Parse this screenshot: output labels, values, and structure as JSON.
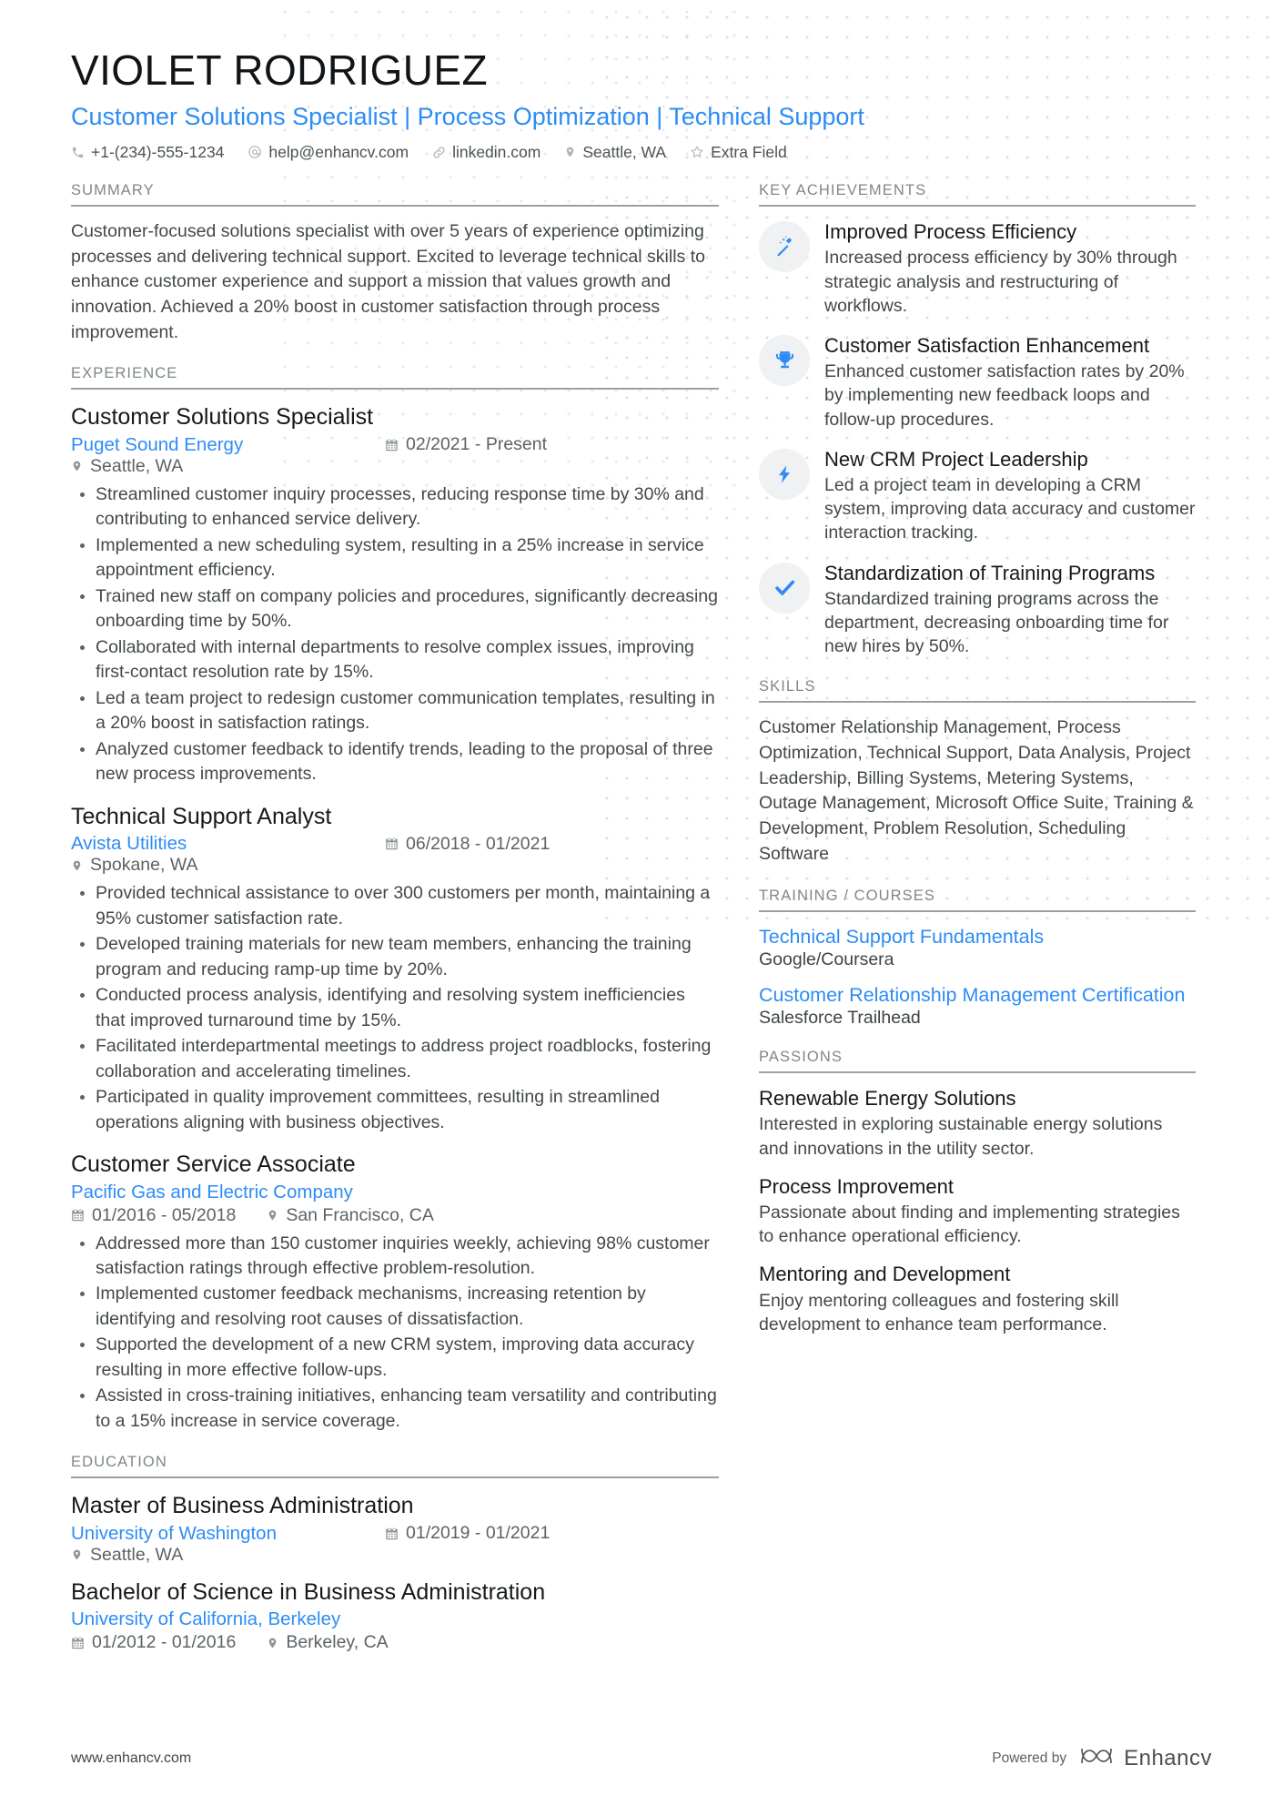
{
  "header": {
    "name": "VIOLET RODRIGUEZ",
    "headline": "Customer Solutions Specialist | Process Optimization | Technical Support",
    "contacts": [
      {
        "icon": "phone-icon",
        "text": "+1-(234)-555-1234"
      },
      {
        "icon": "email-icon",
        "text": "help@enhancv.com"
      },
      {
        "icon": "link-icon",
        "text": "linkedin.com"
      },
      {
        "icon": "location-pin-icon",
        "text": "Seattle, WA"
      },
      {
        "icon": "star-icon",
        "text": "Extra Field"
      }
    ]
  },
  "summary": {
    "title": "SUMMARY",
    "text": "Customer-focused solutions specialist with over 5 years of experience optimizing processes and delivering technical support. Excited to leverage technical skills to enhance customer experience and support a mission that values growth and innovation. Achieved a 20% boost in customer satisfaction through process improvement."
  },
  "experience": {
    "title": "EXPERIENCE",
    "jobs": [
      {
        "role": "Customer Solutions Specialist",
        "company": "Puget Sound Energy",
        "dates": "02/2021 - Present",
        "location": "Seattle, WA",
        "stacked": false,
        "bullets": [
          "Streamlined customer inquiry processes, reducing response time by 30% and contributing to enhanced service delivery.",
          "Implemented a new scheduling system, resulting in a 25% increase in service appointment efficiency.",
          "Trained new staff on company policies and procedures, significantly decreasing onboarding time by 50%.",
          "Collaborated with internal departments to resolve complex issues, improving first-contact resolution rate by 15%.",
          "Led a team project to redesign customer communication templates, resulting in a 20% boost in satisfaction ratings.",
          "Analyzed customer feedback to identify trends, leading to the proposal of three new process improvements."
        ]
      },
      {
        "role": "Technical Support Analyst",
        "company": "Avista Utilities",
        "dates": "06/2018 - 01/2021",
        "location": "Spokane, WA",
        "stacked": false,
        "bullets": [
          "Provided technical assistance to over 300 customers per month, maintaining a 95% customer satisfaction rate.",
          "Developed training materials for new team members, enhancing the training program and reducing ramp-up time by 20%.",
          "Conducted process analysis, identifying and resolving system inefficiencies that improved turnaround time by 15%.",
          "Facilitated interdepartmental meetings to address project roadblocks, fostering collaboration and accelerating timelines.",
          "Participated in quality improvement committees, resulting in streamlined operations aligning with business objectives."
        ]
      },
      {
        "role": "Customer Service Associate",
        "company": "Pacific Gas and Electric Company",
        "dates": "01/2016 - 05/2018",
        "location": "San Francisco, CA",
        "stacked": true,
        "bullets": [
          "Addressed more than 150 customer inquiries weekly, achieving 98% customer satisfaction ratings through effective problem-resolution.",
          "Implemented customer feedback mechanisms, increasing retention by identifying and resolving root causes of dissatisfaction.",
          "Supported the development of a new CRM system, improving data accuracy resulting in more effective follow-ups.",
          "Assisted in cross-training initiatives, enhancing team versatility and contributing to a 15% increase in service coverage."
        ]
      }
    ]
  },
  "education": {
    "title": "EDUCATION",
    "entries": [
      {
        "degree": "Master of Business Administration",
        "school": "University of Washington",
        "dates": "01/2019 - 01/2021",
        "location": "Seattle, WA",
        "stacked": false
      },
      {
        "degree": "Bachelor of Science in Business Administration",
        "school": "University of California, Berkeley",
        "dates": "01/2012 - 01/2016",
        "location": "Berkeley, CA",
        "stacked": true
      }
    ]
  },
  "achievements": {
    "title": "KEY ACHIEVEMENTS",
    "items": [
      {
        "icon": "magic-wand-icon",
        "title": "Improved Process Efficiency",
        "desc": "Increased process efficiency by 30% through strategic analysis and restructuring of workflows."
      },
      {
        "icon": "trophy-icon",
        "title": "Customer Satisfaction Enhancement",
        "desc": "Enhanced customer satisfaction rates by 20% by implementing new feedback loops and follow-up procedures."
      },
      {
        "icon": "lightning-bolt-icon",
        "title": "New CRM Project Leadership",
        "desc": "Led a project team in developing a CRM system, improving data accuracy and customer interaction tracking."
      },
      {
        "icon": "check-icon",
        "title": "Standardization of Training Programs",
        "desc": "Standardized training programs across the department, decreasing onboarding time for new hires by 50%."
      }
    ]
  },
  "skills": {
    "title": "SKILLS",
    "text": "Customer Relationship Management, Process Optimization, Technical Support, Data Analysis, Project Leadership, Billing Systems, Metering Systems, Outage Management, Microsoft Office Suite, Training & Development, Problem Resolution, Scheduling Software"
  },
  "training": {
    "title": "TRAINING / COURSES",
    "courses": [
      {
        "name": "Technical Support Fundamentals",
        "org": "Google/Coursera"
      },
      {
        "name": "Customer Relationship Management Certification",
        "org": "Salesforce Trailhead"
      }
    ]
  },
  "passions": {
    "title": "PASSIONS",
    "items": [
      {
        "title": "Renewable Energy Solutions",
        "desc": "Interested in exploring sustainable energy solutions and innovations in the utility sector."
      },
      {
        "title": "Process Improvement",
        "desc": "Passionate about finding and implementing strategies to enhance operational efficiency."
      },
      {
        "title": "Mentoring and Development",
        "desc": "Enjoy mentoring colleagues and fostering skill development to enhance team performance."
      }
    ]
  },
  "footer": {
    "url": "www.enhancv.com",
    "powered_label": "Powered by",
    "brand": "Enhancv"
  },
  "colors": {
    "accent": "#2d8cf5",
    "text": "#42484b",
    "muted": "#7e878c"
  }
}
